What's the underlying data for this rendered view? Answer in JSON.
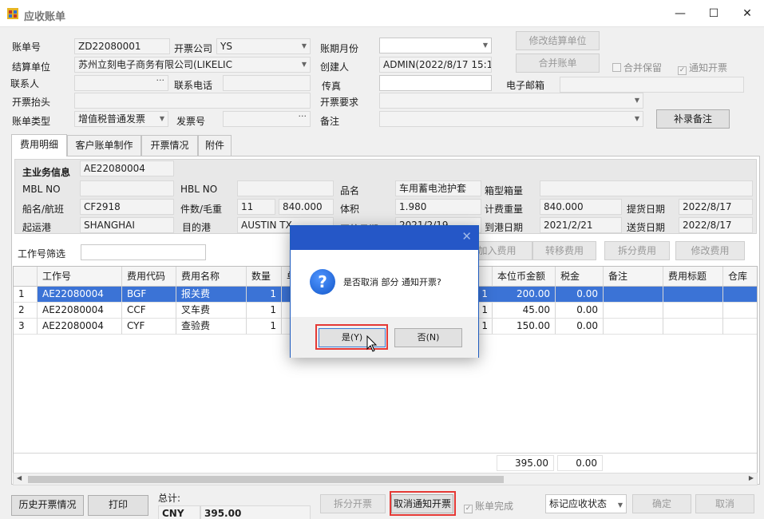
{
  "window": {
    "title": "应收账单",
    "minimize": "—",
    "maximize": "☐",
    "close": "✕"
  },
  "header": {
    "bill_no_label": "账单号",
    "bill_no": "ZD22080001",
    "invoice_company_label": "开票公司",
    "invoice_company": "YS",
    "period_label": "账期月份",
    "period": "",
    "settle_unit_label": "结算单位",
    "settle_unit": "苏州立刻电子商务有限公司(LIKELIC",
    "creator_label": "创建人",
    "creator": "ADMIN(2022/8/17 15:1",
    "contact_label": "联系人",
    "contact": "",
    "phone_label": "联系电话",
    "phone": "",
    "fax_label": "传真",
    "fax": "",
    "email_label": "电子邮箱",
    "email": "",
    "invoice_title_label": "开票抬头",
    "invoice_title": "",
    "invoice_req_label": "开票要求",
    "invoice_req": "",
    "bill_type_label": "账单类型",
    "bill_type": "增值税普通发票",
    "invoice_no_label": "发票号",
    "invoice_no": "",
    "remark_label": "备注",
    "remark": ""
  },
  "buttons": {
    "modify_settle": "修改结算单位",
    "merge_bill": "合并账单",
    "add_remark": "补录备注",
    "add_fee": "加入费用",
    "transfer_fee": "转移费用",
    "split_fee": "拆分费用",
    "modify_fee": "修改费用",
    "history_invoice": "历史开票情况",
    "print": "打印",
    "split_invoice": "拆分开票",
    "cancel_notice": "取消通知开票",
    "confirm": "确定",
    "cancel": "取消"
  },
  "checks": {
    "merge_deposit": "合并保留",
    "notify_invoice": "通知开票",
    "bill_done": "账单完成"
  },
  "tabs": [
    "费用明细",
    "客户账单制作",
    "开票情况",
    "附件"
  ],
  "business": {
    "section_label": "主业务信息",
    "job_no": "AE22080004",
    "mbl_label": "MBL NO",
    "mbl": "",
    "hbl_label": "HBL NO",
    "hbl": "",
    "product_label": "品名",
    "product": "车用蓄电池护套",
    "box_label": "箱型箱量",
    "box": "",
    "vessel_label": "船名/航班",
    "vessel": "CF2918",
    "pkg_label": "件数/毛重",
    "pkg": "11",
    "gross": "840.000",
    "volume_label": "体积",
    "volume": "1.980",
    "charge_wt_label": "计费重量",
    "charge_wt": "840.000",
    "pickup_label": "提货日期",
    "pickup": "2022/8/17",
    "pol_label": "起运港",
    "pol": "SHANGHAI",
    "pod_label": "目的港",
    "pod": "AUSTIN TX",
    "sail_label": "开航日期",
    "sail": "2021/2/19",
    "arrive_label": "到港日期",
    "arrive": "2021/2/21",
    "deliver_label": "送货日期",
    "deliver": "2022/8/17"
  },
  "filter": {
    "label": "工作号筛选",
    "value": ""
  },
  "table": {
    "headers": [
      "工作号",
      "费用代码",
      "费用名称",
      "数量",
      "单",
      "本位币金额",
      "税金",
      "备注",
      "费用标题",
      "仓库"
    ],
    "rows": [
      {
        "idx": "1",
        "job": "AE22080004",
        "code": "BGF",
        "name": "报关费",
        "qty": "1",
        "rate": "1",
        "amount": "200.00",
        "tax": "0.00"
      },
      {
        "idx": "2",
        "job": "AE22080004",
        "code": "CCF",
        "name": "叉车费",
        "qty": "1",
        "rate": "1",
        "amount": "45.00",
        "tax": "0.00"
      },
      {
        "idx": "3",
        "job": "AE22080004",
        "code": "CYF",
        "name": "查验费",
        "qty": "1",
        "rate": "1",
        "amount": "150.00",
        "tax": "0.00"
      }
    ],
    "total_amount": "395.00",
    "total_tax": "0.00"
  },
  "footer": {
    "total_label": "总计:",
    "currency": "CNY",
    "total": "395.00",
    "status_select": "标记应收状态"
  },
  "dialog": {
    "message": "是否取消 部分 通知开票?",
    "yes": "是(Y)",
    "no": "否(N)",
    "icon": "question-icon"
  }
}
